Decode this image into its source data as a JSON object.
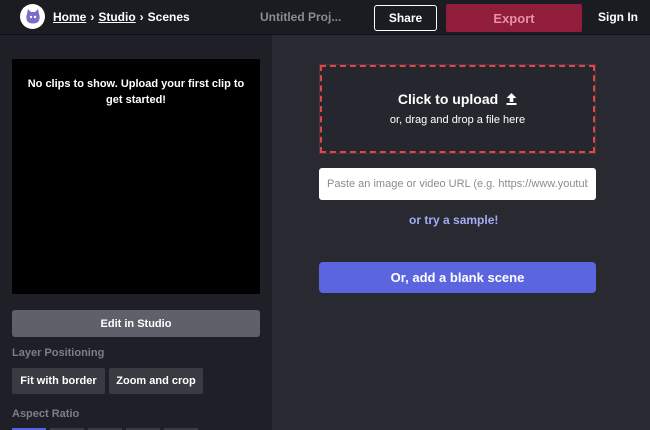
{
  "header": {
    "breadcrumb": [
      {
        "label": "Home"
      },
      {
        "label": "Studio"
      },
      {
        "label": "Scenes"
      }
    ],
    "separator": "›",
    "project_title": "Untitled Proj...",
    "share_label": "Share",
    "export_label": "Export",
    "signin_label": "Sign In",
    "logo_icon": "cat-mascot-icon"
  },
  "left_panel": {
    "preview_message": "No clips to show. Upload your first clip to get started!",
    "edit_studio_label": "Edit in Studio",
    "layer_positioning_label": "Layer Positioning",
    "fit_with_border_label": "Fit with border",
    "zoom_and_crop_label": "Zoom and crop",
    "aspect_ratio_label": "Aspect Ratio"
  },
  "main": {
    "upload_title": "Click to upload",
    "upload_icon": "upload-arrow-icon",
    "upload_subtitle": "or, drag and drop a file here",
    "url_placeholder": "Paste an image or video URL (e.g. https://www.youtube.com/...)",
    "sample_link": "or try a sample!",
    "blank_scene_label": "Or, add a blank scene"
  },
  "colors": {
    "background": "#292a31",
    "topbar": "#1b1c21",
    "export": "#8f1d3b",
    "accent": "#5b65e0",
    "upload_border": "#d84a4a"
  }
}
